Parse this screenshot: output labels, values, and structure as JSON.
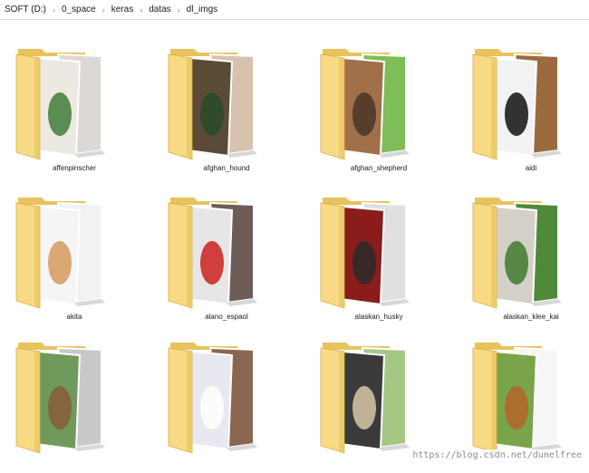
{
  "breadcrumb": [
    "SOFT (D:)",
    "0_space",
    "keras",
    "datas",
    "dl_imgs"
  ],
  "folders": [
    {
      "name": "affenpinscher",
      "back": "#dcd8d4",
      "front": "#ece8e2",
      "accent": "#3f7c3a"
    },
    {
      "name": "afghan_hound",
      "back": "#d7c3ad",
      "front": "#5a4a36",
      "accent": "#2c4a2a"
    },
    {
      "name": "afghan_shepherd",
      "back": "#7ebd58",
      "front": "#a0704a",
      "accent": "#4a3426"
    },
    {
      "name": "aidi",
      "back": "#9b6a3f",
      "front": "#f2f2f2",
      "accent": "#111111"
    },
    {
      "name": "akita",
      "back": "#f0f2f4",
      "front": "#f5f5f5",
      "accent": "#d39a5c"
    },
    {
      "name": "alano_espaol",
      "back": "#6e5c58",
      "front": "#e6e6e6",
      "accent": "#cc2020"
    },
    {
      "name": "alaskan_husky",
      "back": "#e0e0e0",
      "front": "#8a1c1c",
      "accent": "#2a2a2a"
    },
    {
      "name": "alaskan_klee_kai",
      "back": "#4f8a3a",
      "front": "#d4d0c8",
      "accent": "#3f7a2f"
    },
    {
      "name": "",
      "back": "#c8c8c8",
      "front": "#6f9a5c",
      "accent": "#8a5a3a"
    },
    {
      "name": "",
      "back": "#8a6650",
      "front": "#e8e8f0",
      "accent": "#ffffff"
    },
    {
      "name": "",
      "back": "#a4c884",
      "front": "#3a3a3a",
      "accent": "#d8c8a8"
    },
    {
      "name": "",
      "back": "#f6f6f6",
      "front": "#7aa44a",
      "accent": "#b5652a"
    }
  ],
  "watermark": "https://blog.csdn.net/dunelfree",
  "colors": {
    "folder_back": "#e8c25c",
    "folder_front": "#f7da83",
    "folder_edge": "#d8ad45"
  }
}
